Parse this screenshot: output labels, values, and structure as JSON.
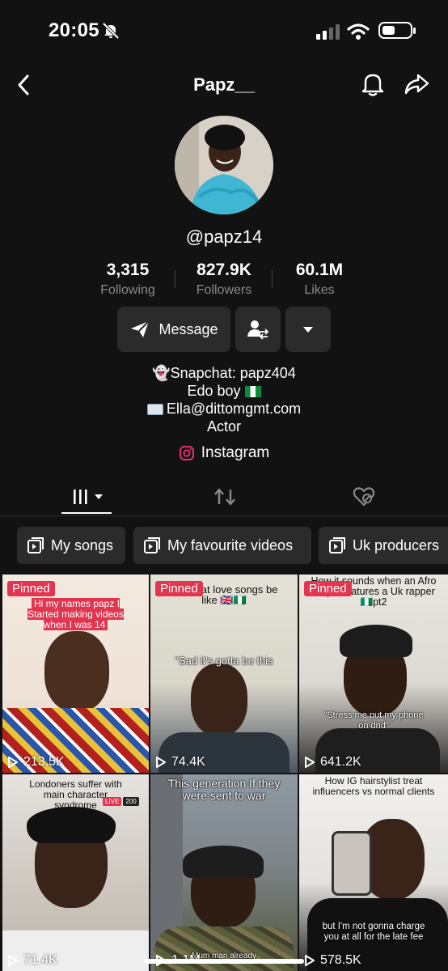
{
  "status": {
    "time": "20:05"
  },
  "header": {
    "title": "Papz__"
  },
  "profile": {
    "handle": "@papz14",
    "stats": [
      {
        "value": "3,315",
        "label": "Following"
      },
      {
        "value": "827.9K",
        "label": "Followers"
      },
      {
        "value": "60.1M",
        "label": "Likes"
      }
    ],
    "message_label": "Message",
    "bio": [
      "👻Snapchat: papz404",
      "Edo boy",
      "Ella@dittomgmt.com",
      "Actor"
    ],
    "link": "Instagram"
  },
  "playlists": [
    "My songs",
    "My favourite videos",
    "Uk producers"
  ],
  "videos": [
    {
      "pinned": "Pinned",
      "caption": "Hi my names papz I Started making videos when I was 14",
      "views": "213.5K"
    },
    {
      "pinned": "Pinned",
      "caption": "Afrobeat love songs be like 🇬🇧🇳🇬",
      "caption2": "\"Sad it's gotta be this",
      "views": "74.4K"
    },
    {
      "pinned": "Pinned",
      "caption": "How it sounds when an Afro singer features a Uk rapper 🇳🇬pt2",
      "caption2": "\"Stress me put my phone on dnd\"",
      "views": "641.2K"
    },
    {
      "caption": "Londoners suffer with main character syndrome",
      "badge_live": "LIVE",
      "badge_count": "200",
      "views": "71.4K"
    },
    {
      "caption": "This generation If they were sent to war",
      "caption2": "Mum man already",
      "views": "1.1M"
    },
    {
      "caption": "How IG hairstylist treat influencers vs normal clients",
      "caption2": "but I'm not gonna charge you at all for the late fee",
      "views": "578.5K"
    }
  ],
  "colors": {
    "bg": "#121212",
    "button": "#2b2b2b",
    "pinned": "#e2354f",
    "muted": "#8a8a8a"
  }
}
